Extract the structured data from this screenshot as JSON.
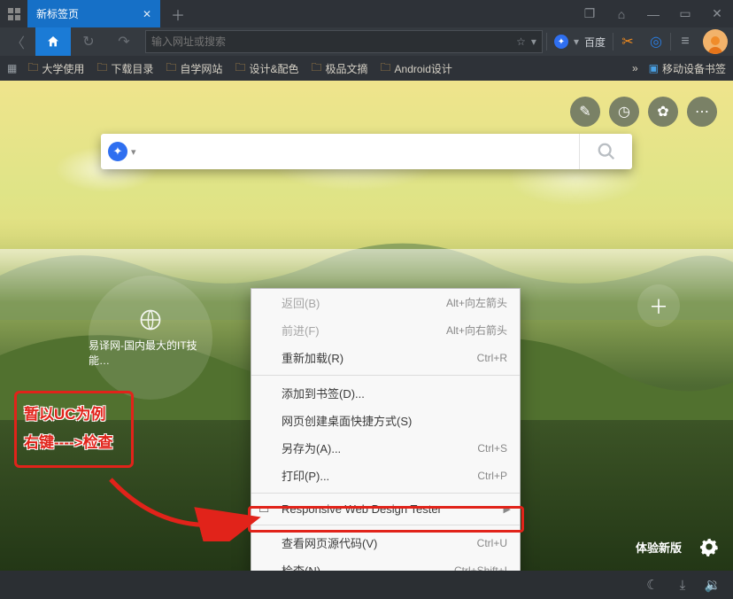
{
  "tab": {
    "title": "新标签页"
  },
  "address": {
    "placeholder": "输入网址或搜索"
  },
  "search_engine": {
    "name": "百度"
  },
  "bookmarks": [
    {
      "label": "大学使用"
    },
    {
      "label": "下载目录"
    },
    {
      "label": "自学网站"
    },
    {
      "label": "设计&配色"
    },
    {
      "label": "极品文摘"
    },
    {
      "label": "Android设计"
    }
  ],
  "bookmark_right": {
    "label": "移动设备书签"
  },
  "dial": {
    "label": "易译网-国内最大的IT技能…"
  },
  "context_menu": {
    "groups": [
      [
        {
          "label": "返回(B)",
          "shortcut": "Alt+向左箭头",
          "disabled": true
        },
        {
          "label": "前进(F)",
          "shortcut": "Alt+向右箭头",
          "disabled": true
        },
        {
          "label": "重新加载(R)",
          "shortcut": "Ctrl+R"
        }
      ],
      [
        {
          "label": "添加到书签(D)..."
        },
        {
          "label": "网页创建桌面快捷方式(S)"
        },
        {
          "label": "另存为(A)...",
          "shortcut": "Ctrl+S"
        },
        {
          "label": "打印(P)...",
          "shortcut": "Ctrl+P"
        }
      ],
      [
        {
          "label": "Responsive Web Design Tester",
          "submenu": true,
          "has_icon": true
        }
      ],
      [
        {
          "label": "查看网页源代码(V)",
          "shortcut": "Ctrl+U"
        },
        {
          "label": "检查(N)",
          "shortcut": "Ctrl+Shift+I"
        }
      ]
    ]
  },
  "annotation": {
    "line1": "暂以UC为例",
    "line2": "右键---->检查"
  },
  "bottom": {
    "experience": "体验新版"
  }
}
